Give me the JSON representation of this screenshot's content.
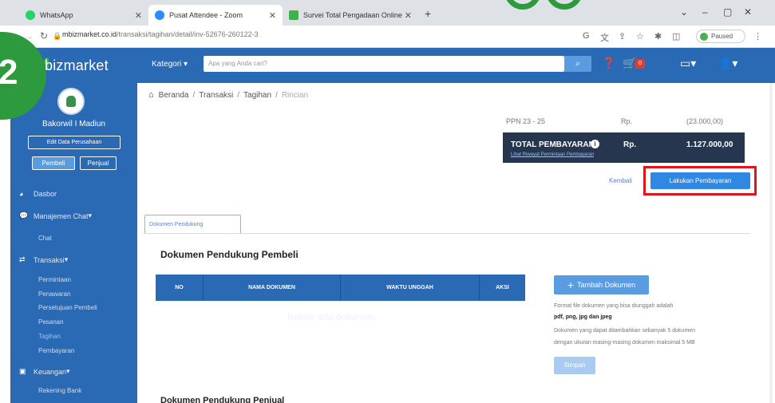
{
  "browser": {
    "tabs": [
      {
        "label": "WhatsApp",
        "color": "#25d366"
      },
      {
        "label": "Pusat Attendee - Zoom",
        "color": "#2d8cff"
      },
      {
        "label": "Survei Total Pengadaan Online",
        "color": "#3cb44b"
      }
    ],
    "url_host": "mbizmarket.co.id",
    "url_path": "/transaksi/tagihan/detail/inv-52676-260122-3",
    "profile_status": "Paused"
  },
  "header": {
    "logo": "bizmarket",
    "category_label": "Kategori",
    "search_placeholder": "Apa yang Anda cari?",
    "cart_count": "0"
  },
  "sidebar": {
    "store_name": "Bakorwil I Madiun",
    "edit_label": "Edit Data Perusahaan",
    "role_buyer": "Pembeli",
    "role_seller": "Penjual",
    "items": [
      {
        "label": "Dasbor"
      },
      {
        "label": "Manajemen Chat"
      },
      {
        "label": "Chat"
      },
      {
        "label": "Transaksi"
      },
      {
        "label": "Permintaan"
      },
      {
        "label": "Penawaran"
      },
      {
        "label": "Persetujuan Pembeli"
      },
      {
        "label": "Pesanan"
      },
      {
        "label": "Tagihan"
      },
      {
        "label": "Pembayaran"
      },
      {
        "label": "Keuangan"
      },
      {
        "label": "Rekening Bank"
      }
    ]
  },
  "step_number": "2",
  "breadcrumb": [
    "Beranda",
    "Transaksi",
    "Tagihan",
    "Rincian"
  ],
  "ppn": {
    "label": "PPN 23 - 25",
    "currency": "Rp.",
    "value": "(23.000,00)"
  },
  "total": {
    "label": "TOTAL PEMBAYARAN",
    "link": "Lihat Riwayat Permintaan Pembayaran",
    "currency": "Rp.",
    "value": "1.127.000,00"
  },
  "actions": {
    "back": "Kembali",
    "pay": "Lakukan Pembayaran"
  },
  "tab_doc": "Dokumen Pendukung",
  "section_title": "Dokumen Pendukung Pembeli",
  "table_headers": [
    "NO",
    "NAMA DOKUMEN",
    "WAKTU UNGGAH",
    "AKSI"
  ],
  "empty_text": "Belum ada dokumen",
  "upload": {
    "add_label": "Tambah Dokumen",
    "note1": "Format file dokumen yang bisa diunggah adalah",
    "note2": "pdf, png, jpg dan jpeg",
    "note3": "Dokumen yang dapat ditambahkan sebanyak 5 dokumen",
    "note4": "dengan ukuran masing-masing dokumen maksimal 5 MB",
    "save_label": "Simpan"
  },
  "bottom_title": "Dokumen Pendukung Penjual"
}
